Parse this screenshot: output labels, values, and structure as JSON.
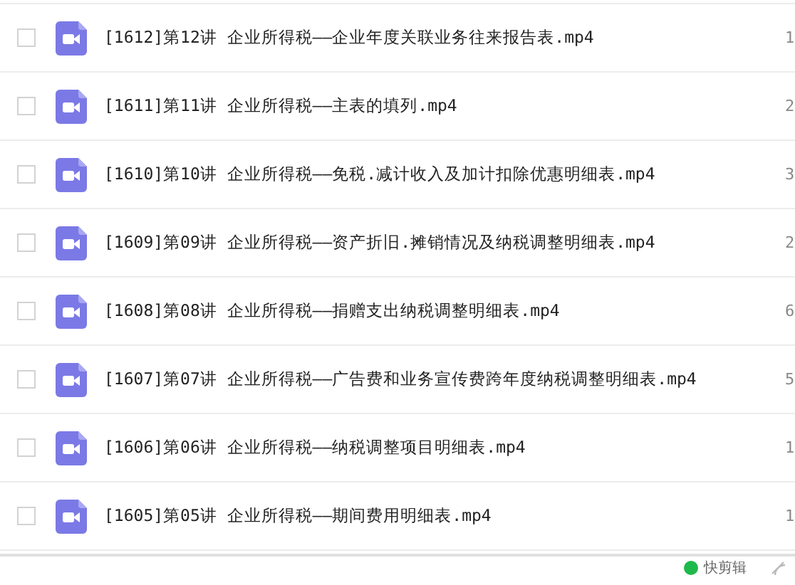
{
  "files": [
    {
      "name": "[1612]第12讲 企业所得税——企业年度关联业务往来报告表.mp4",
      "checked": false,
      "column_3": "1"
    },
    {
      "name": "[1611]第11讲 企业所得税——主表的填列.mp4",
      "checked": false,
      "column_3": "2"
    },
    {
      "name": "[1610]第10讲 企业所得税——免税.减计收入及加计扣除优惠明细表.mp4",
      "checked": false,
      "column_3": "3"
    },
    {
      "name": "[1609]第09讲 企业所得税——资产折旧.摊销情况及纳税调整明细表.mp4",
      "checked": false,
      "column_3": "2"
    },
    {
      "name": "[1608]第08讲 企业所得税——捐赠支出纳税调整明细表.mp4",
      "checked": false,
      "column_3": "6"
    },
    {
      "name": "[1607]第07讲 企业所得税——广告费和业务宣传费跨年度纳税调整明细表.mp4",
      "checked": false,
      "column_3": "5"
    },
    {
      "name": "[1606]第06讲 企业所得税——纳税调整项目明细表.mp4",
      "checked": false,
      "column_3": "1"
    },
    {
      "name": "[1605]第05讲 企业所得税——期间费用明细表.mp4",
      "checked": false,
      "column_3": "1"
    }
  ],
  "status_bar": {
    "app_label": "快剪辑"
  }
}
